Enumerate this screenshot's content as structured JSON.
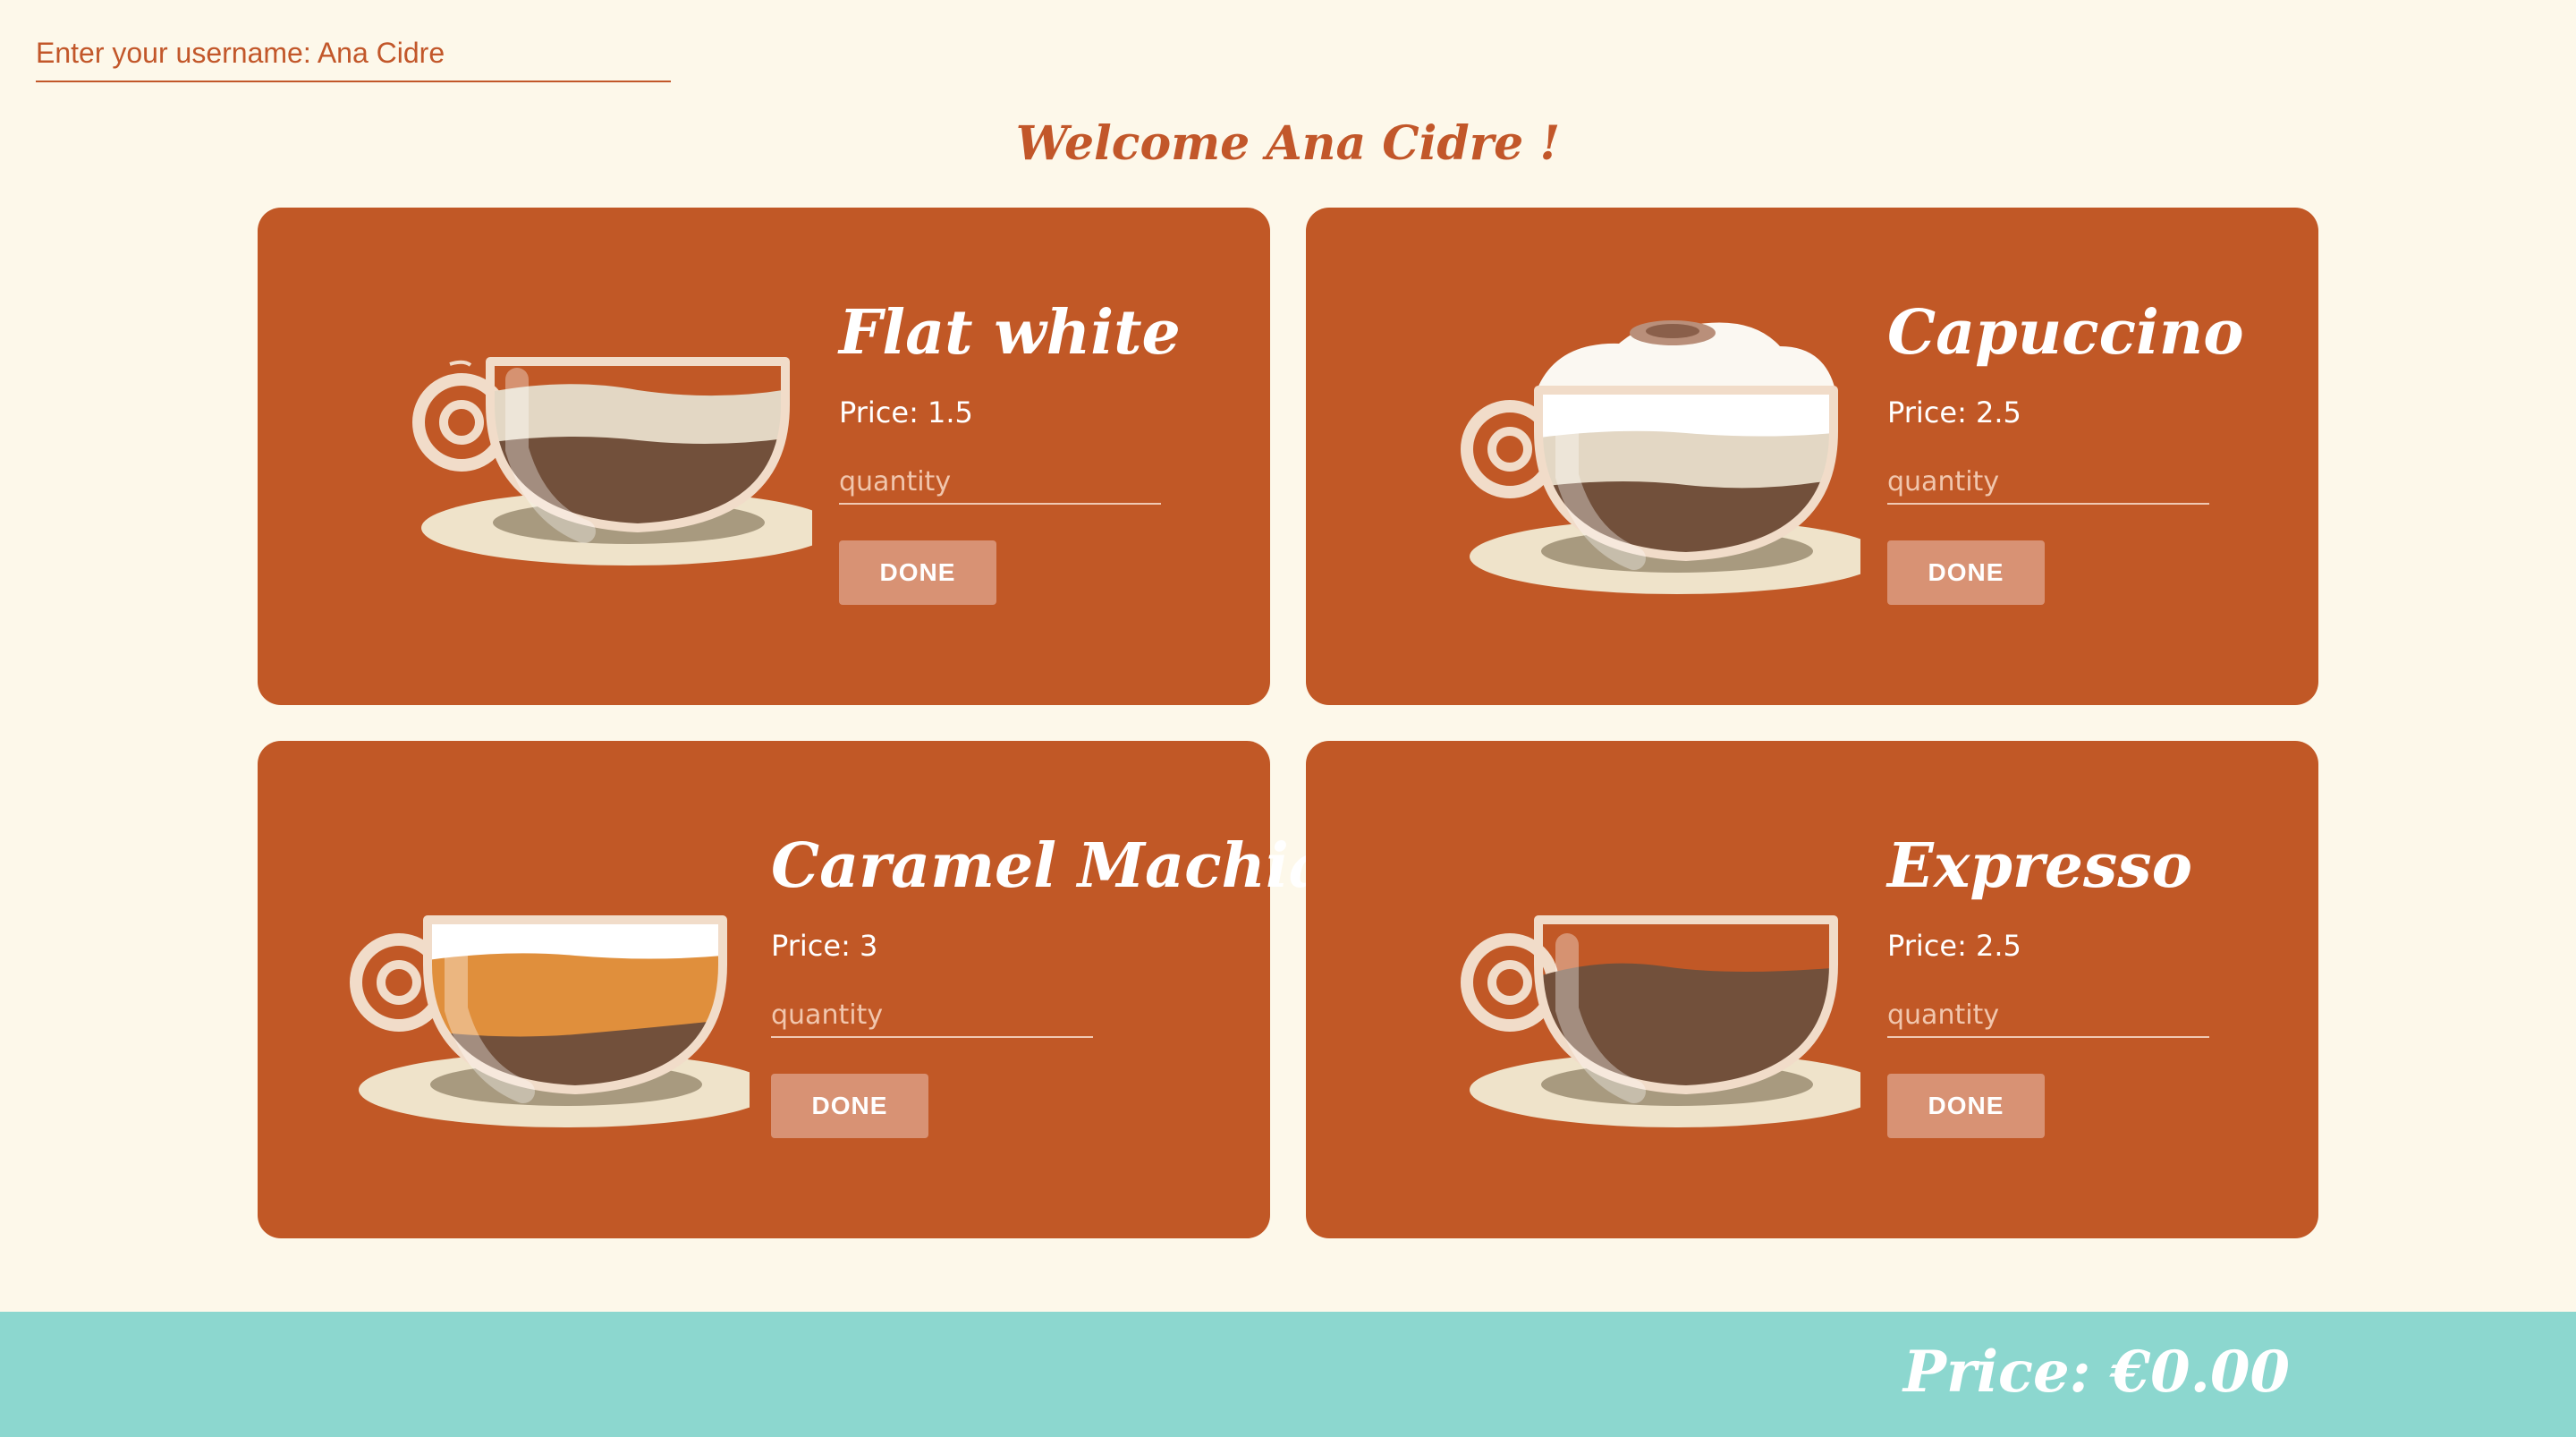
{
  "username": {
    "value": "Enter your username: Ana Cidre"
  },
  "welcome": "Welcome Ana Cidre !",
  "coffees": [
    {
      "name": "Flat white",
      "price_label": "Price: 1.5",
      "quantity_placeholder": "quantity",
      "done_label": "DONE",
      "cup_icon": "flat-white-cup-icon"
    },
    {
      "name": "Capuccino",
      "price_label": "Price: 2.5",
      "quantity_placeholder": "quantity",
      "done_label": "DONE",
      "cup_icon": "capuccino-cup-icon"
    },
    {
      "name": "Caramel Machiato",
      "price_label": "Price: 3",
      "quantity_placeholder": "quantity",
      "done_label": "DONE",
      "cup_icon": "caramel-machiato-cup-icon"
    },
    {
      "name": "Expresso",
      "price_label": "Price: 2.5",
      "quantity_placeholder": "quantity",
      "done_label": "DONE",
      "cup_icon": "expresso-cup-icon"
    }
  ],
  "footer": {
    "total_price": "Price: €0.00"
  },
  "colors": {
    "background": "#fdf8ea",
    "accent": "#c15826",
    "button": "#d89274",
    "footer": "#8cd7cf",
    "coffee": "#72503b",
    "milk_foam": "#e6dccb",
    "caramel": "#e08f3c"
  }
}
